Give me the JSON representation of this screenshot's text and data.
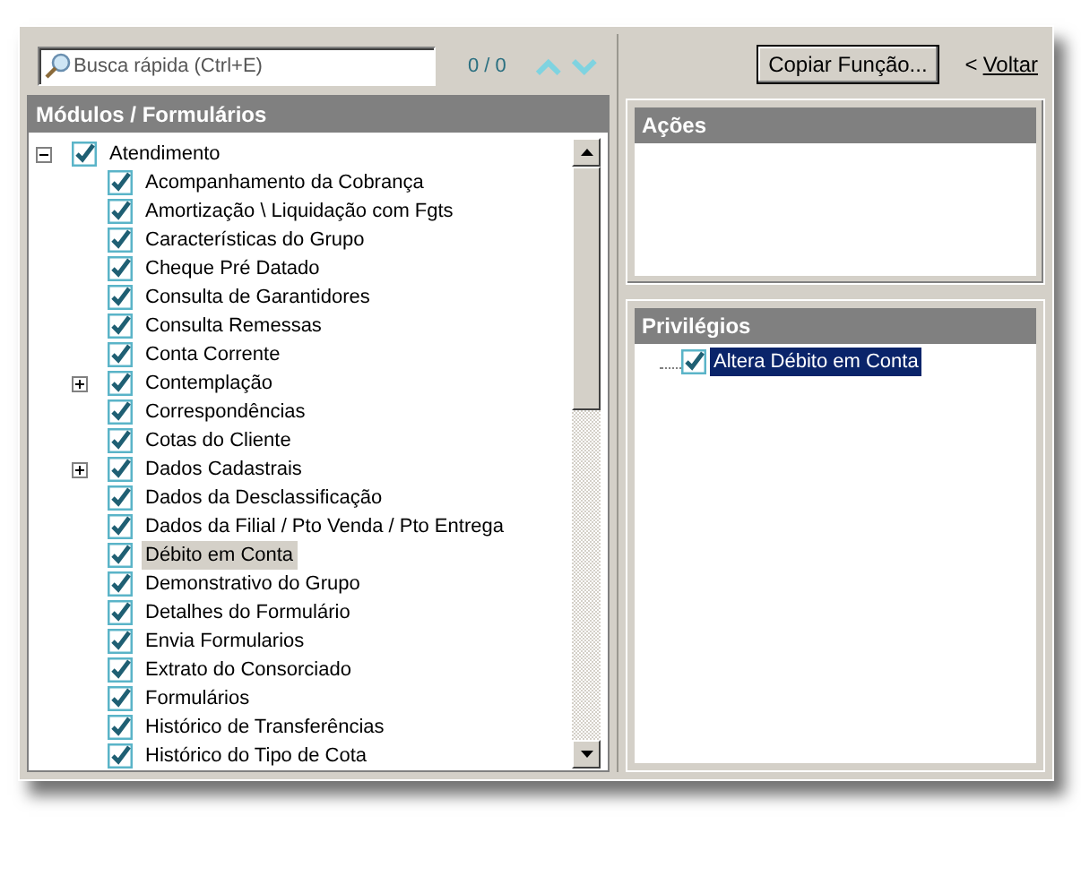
{
  "search": {
    "placeholder": "Busca rápida (Ctrl+E)",
    "count": "0 / 0"
  },
  "copy_button": "Copiar Função...",
  "back_link": {
    "arrow": "<",
    "label": "Voltar"
  },
  "modules_panel": {
    "title": "Módulos / Formulários",
    "tree": [
      {
        "label": "Atendimento",
        "checked": true,
        "expanded": true,
        "selected": false,
        "children": [
          {
            "label": "Acompanhamento da Cobrança",
            "checked": true,
            "selected": false
          },
          {
            "label": "Amortização \\ Liquidação com Fgts",
            "checked": true,
            "selected": false
          },
          {
            "label": "Características do Grupo",
            "checked": true,
            "selected": false
          },
          {
            "label": "Cheque Pré Datado",
            "checked": true,
            "selected": false
          },
          {
            "label": "Consulta de Garantidores",
            "checked": true,
            "selected": false
          },
          {
            "label": "Consulta Remessas",
            "checked": true,
            "selected": false
          },
          {
            "label": "Conta Corrente",
            "checked": true,
            "selected": false
          },
          {
            "label": "Contemplação",
            "checked": true,
            "selected": false,
            "expanded": false
          },
          {
            "label": "Correspondências",
            "checked": true,
            "selected": false
          },
          {
            "label": "Cotas do Cliente",
            "checked": true,
            "selected": false
          },
          {
            "label": "Dados Cadastrais",
            "checked": true,
            "selected": false,
            "expanded": false
          },
          {
            "label": "Dados da Desclassificação",
            "checked": true,
            "selected": false
          },
          {
            "label": "Dados da Filial / Pto Venda / Pto Entrega",
            "checked": true,
            "selected": false
          },
          {
            "label": "Débito em Conta",
            "checked": true,
            "selected": true
          },
          {
            "label": "Demonstrativo do Grupo",
            "checked": true,
            "selected": false
          },
          {
            "label": "Detalhes do Formulário",
            "checked": true,
            "selected": false
          },
          {
            "label": "Envia Formularios",
            "checked": true,
            "selected": false
          },
          {
            "label": "Extrato do Consorciado",
            "checked": true,
            "selected": false
          },
          {
            "label": "Formulários",
            "checked": true,
            "selected": false
          },
          {
            "label": "Histórico de Transferências",
            "checked": true,
            "selected": false
          },
          {
            "label": "Histórico do Tipo de Cota",
            "checked": true,
            "selected": false
          }
        ]
      }
    ]
  },
  "actions_panel": {
    "title": "Ações"
  },
  "privileges_panel": {
    "title": "Privilégios",
    "items": [
      {
        "label": "Altera Débito em Conta",
        "checked": true,
        "selected": true
      }
    ]
  }
}
